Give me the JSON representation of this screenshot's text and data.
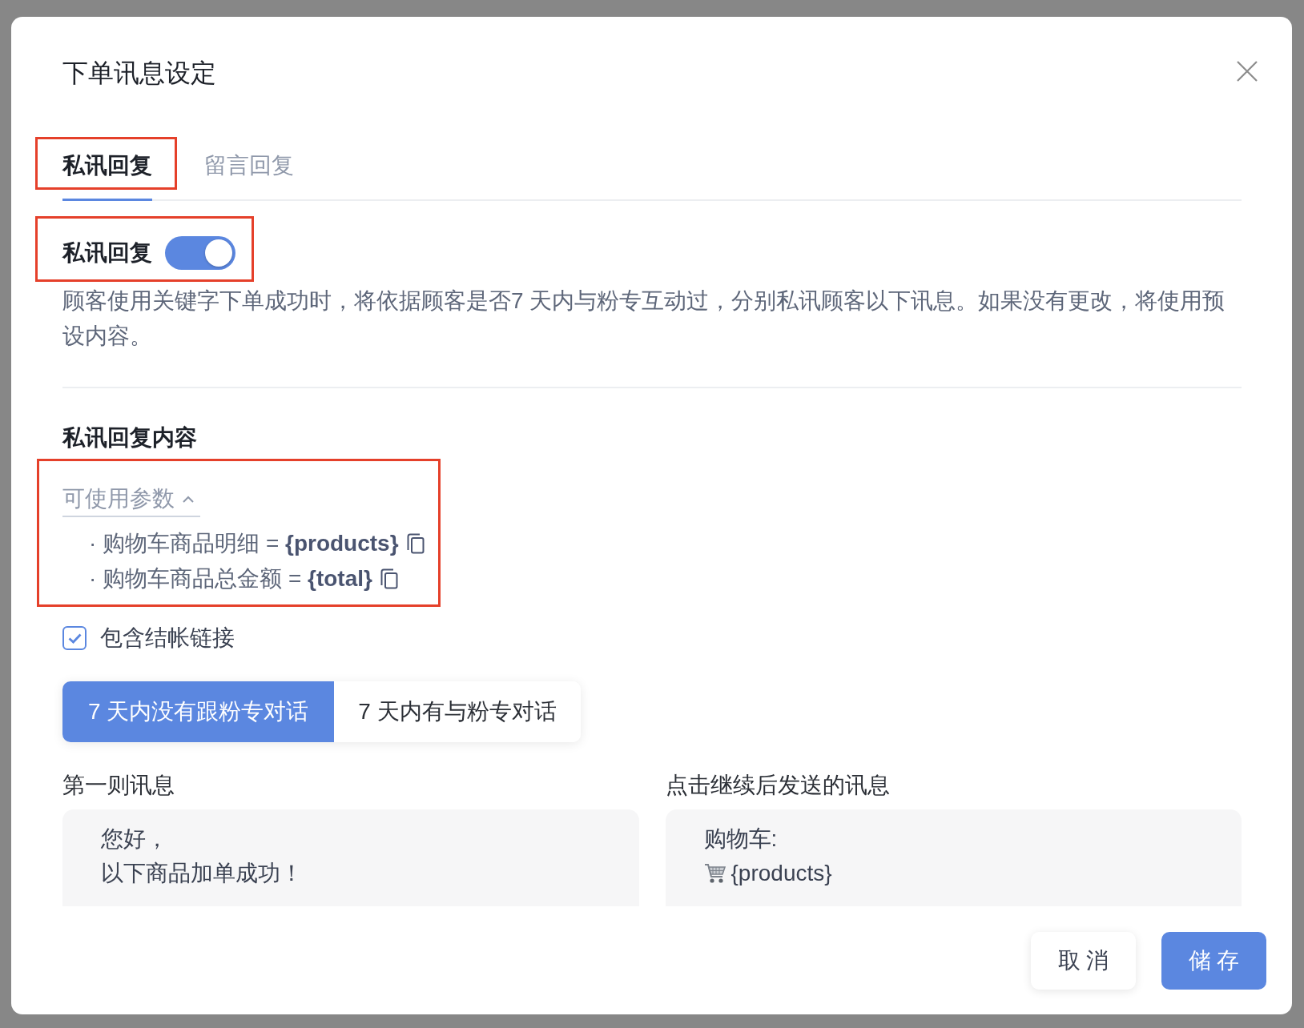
{
  "dialog": {
    "title": "下单讯息设定"
  },
  "tabs": [
    {
      "label": "私讯回复",
      "selected": true,
      "highlighted": true
    },
    {
      "label": "留言回复",
      "selected": false,
      "highlighted": false
    }
  ],
  "private_reply": {
    "label": "私讯回复",
    "on": true,
    "highlighted": true,
    "description": "顾客使用关键字下单成功时，将依据顾客是否7 天内与粉专互动过，分别私讯顾客以下讯息。如果没有更改，将使用预设内容。"
  },
  "content": {
    "title": "私讯回复内容",
    "parameters": {
      "label": "可使用参数",
      "expanded": true,
      "highlighted": true,
      "items": [
        {
          "text": "· 购物车商品明细 = **{products}**"
        },
        {
          "text": "· 购物车商品总金额 = **{total}**"
        }
      ]
    },
    "checkout_link": {
      "label": "包含结帐链接",
      "checked": true
    },
    "segments": [
      {
        "label": "7 天内没有跟粉专对话",
        "selected": true
      },
      {
        "label": "7 天内有与粉专对话",
        "selected": false
      }
    ],
    "messages": [
      {
        "label": "第一则讯息",
        "lines": [
          {
            "kind": "text",
            "text": "您好，"
          },
          {
            "kind": "text",
            "text": "以下商品加单成功！"
          }
        ]
      },
      {
        "label": "点击继续后发送的讯息",
        "lines": [
          {
            "kind": "text",
            "text": "购物车:"
          },
          {
            "kind": "cart",
            "text": "{products}"
          }
        ]
      }
    ]
  },
  "buttons": [
    {
      "label": "取 消",
      "kind": "secondary"
    },
    {
      "label": "储 存",
      "kind": "primary"
    }
  ]
}
